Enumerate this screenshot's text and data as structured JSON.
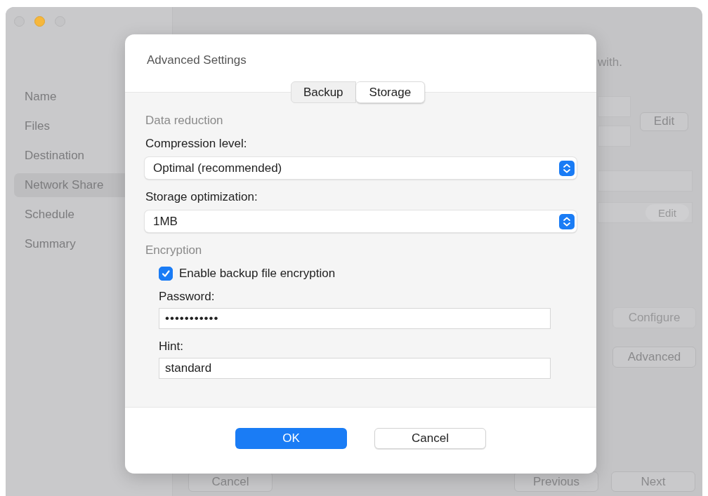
{
  "sidebar": {
    "items": [
      {
        "label": "Name",
        "selected": false
      },
      {
        "label": "Files",
        "selected": false
      },
      {
        "label": "Destination",
        "selected": false
      },
      {
        "label": "Network Share",
        "selected": true
      },
      {
        "label": "Schedule",
        "selected": false
      },
      {
        "label": "Summary",
        "selected": false
      }
    ]
  },
  "content": {
    "subtitle_fragment": "with.",
    "edit_button": {
      "label": "Edit",
      "disabled": false
    },
    "share_edit_button": {
      "label": "Edit",
      "disabled": true
    },
    "configure_button": {
      "label": "Configure",
      "disabled": true
    },
    "advanced_button": {
      "label": "Advanced",
      "disabled": false
    }
  },
  "footer": {
    "buttons": [
      {
        "label": "Cancel"
      },
      {
        "label": "Previous"
      },
      {
        "label": "Next"
      }
    ]
  },
  "dialog": {
    "title": "Advanced Settings",
    "tabs": [
      {
        "label": "Backup",
        "selected": false
      },
      {
        "label": "Storage",
        "selected": true
      }
    ],
    "data_reduction": {
      "heading": "Data reduction",
      "compression": {
        "label": "Compression level:",
        "value": "Optimal (recommended)"
      },
      "storage_optimization": {
        "label": "Storage optimization:",
        "value": "1MB"
      }
    },
    "encryption": {
      "heading": "Encryption",
      "enable": {
        "label": "Enable backup file encryption",
        "checked": true
      },
      "password": {
        "label": "Password:",
        "value": "•••••••••••"
      },
      "hint": {
        "label": "Hint:",
        "value": "standard"
      }
    },
    "buttons": [
      {
        "label": "OK",
        "kind": "primary"
      },
      {
        "label": "Cancel",
        "kind": "secondary"
      }
    ]
  }
}
